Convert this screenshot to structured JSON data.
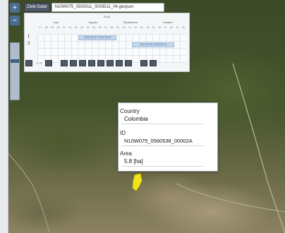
{
  "file_bar": {
    "button_label": "Ziele Datei",
    "file_name": "N10W075_0500311_0003511_04.geojson"
  },
  "zoom": {
    "in_symbol": "+",
    "out_symbol": "−",
    "level": 0.7
  },
  "timeline": {
    "year": "2016",
    "months": [
      "Julio",
      "Agosto",
      "Septiembre",
      "Octubre"
    ],
    "days": [
      "27",
      "28",
      "29",
      "30",
      "31",
      "01",
      "02",
      "03",
      "04",
      "05",
      "06",
      "07",
      "08",
      "09",
      "10",
      "11",
      "12",
      "13",
      "14",
      "15",
      "16",
      "17",
      "18",
      "19",
      "20"
    ],
    "rows": [
      {
        "num": "1",
        "bar_label": "2016-08-18 / 2016-08-29"
      },
      {
        "num": "2",
        "bar_label": "2016-09-08 / 2016-09-21"
      }
    ],
    "pager_text": "1 / 3"
  },
  "popup": {
    "country_label": "Country",
    "country_value": "Colombia",
    "id_label": "ID",
    "id_value": "N10W075_0560538_00002A",
    "area_label": "Area",
    "area_value": "5.8 [ha]"
  },
  "colors": {
    "polygon": "#f2e21a",
    "button": "#4f5a68",
    "bar": "#c3d8ee"
  }
}
